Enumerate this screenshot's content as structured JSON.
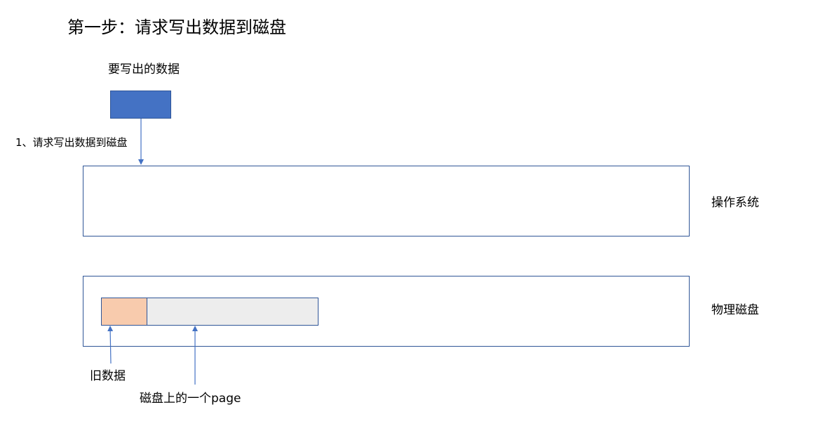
{
  "title": "第一步：请求写出数据到磁盘",
  "data_label": "要写出的数据",
  "request_label": "1、请求写出数据到磁盘",
  "os_label": "操作系统",
  "disk_label": "物理磁盘",
  "old_data_label": "旧数据",
  "page_label": "磁盘上的一个page",
  "colors": {
    "data_block": "#4472c4",
    "old_data": "#f8cbad",
    "page": "#ededed",
    "border": "#2f5597",
    "arrow": "#4472c4"
  }
}
